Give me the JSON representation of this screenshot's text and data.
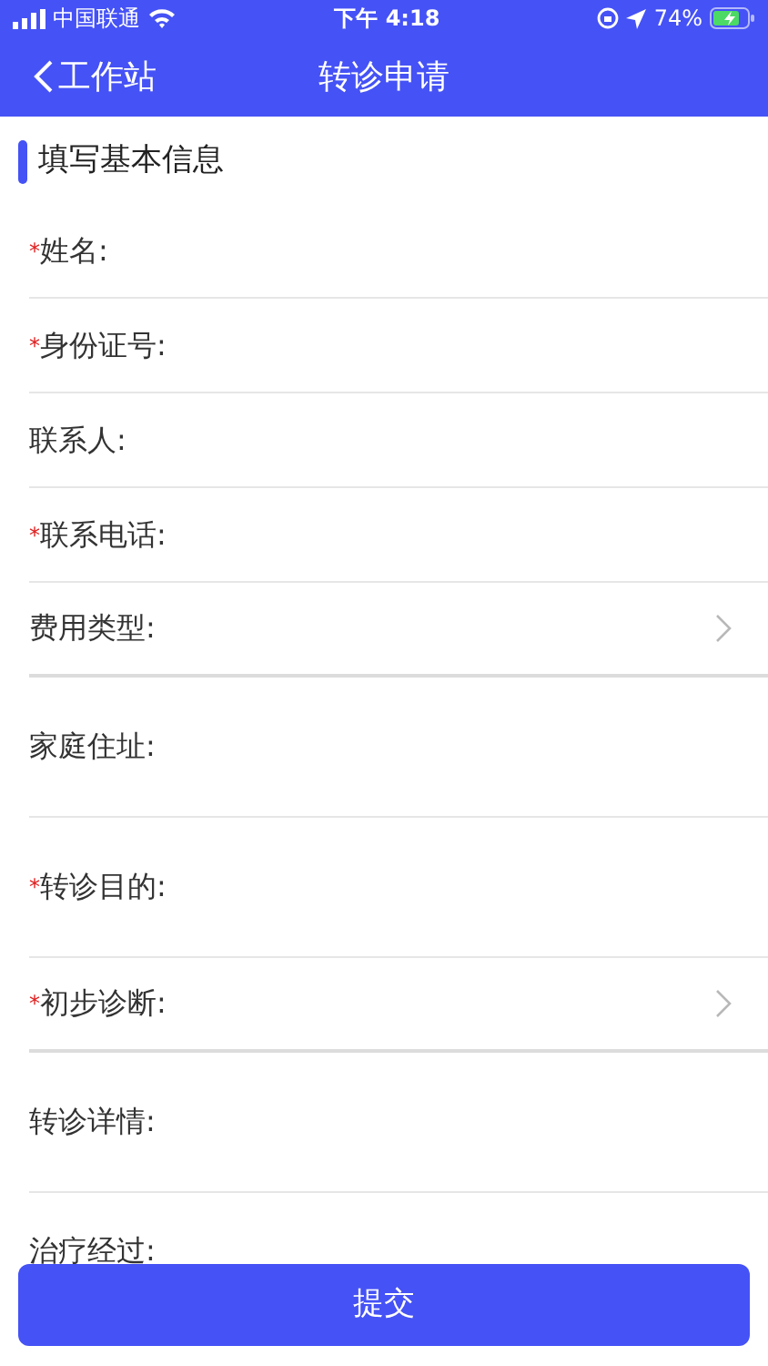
{
  "status_bar": {
    "carrier": "中国联通",
    "time": "下午 4:18",
    "battery": "74%"
  },
  "nav": {
    "back": "工作站",
    "title": "转诊申请"
  },
  "section_title": "填写基本信息",
  "fields": [
    {
      "kind": "text",
      "label": "姓名:",
      "required_mark": "*"
    },
    {
      "kind": "text",
      "label": "身份证号:",
      "required_mark": "*"
    },
    {
      "kind": "text",
      "label": "联系人:"
    },
    {
      "kind": "text",
      "label": "联系电话:",
      "required_mark": "*"
    },
    {
      "kind": "select",
      "label": "费用类型:"
    },
    {
      "kind": "textarea",
      "label": "家庭住址:"
    },
    {
      "kind": "textarea",
      "label": "转诊目的:",
      "required_mark": "*"
    },
    {
      "kind": "select",
      "label": "初步诊断:",
      "required_mark": "*"
    },
    {
      "kind": "textarea",
      "label": "转诊详情:"
    },
    {
      "kind": "cut",
      "label": "治疗经过:"
    }
  ],
  "submit": "提交"
}
